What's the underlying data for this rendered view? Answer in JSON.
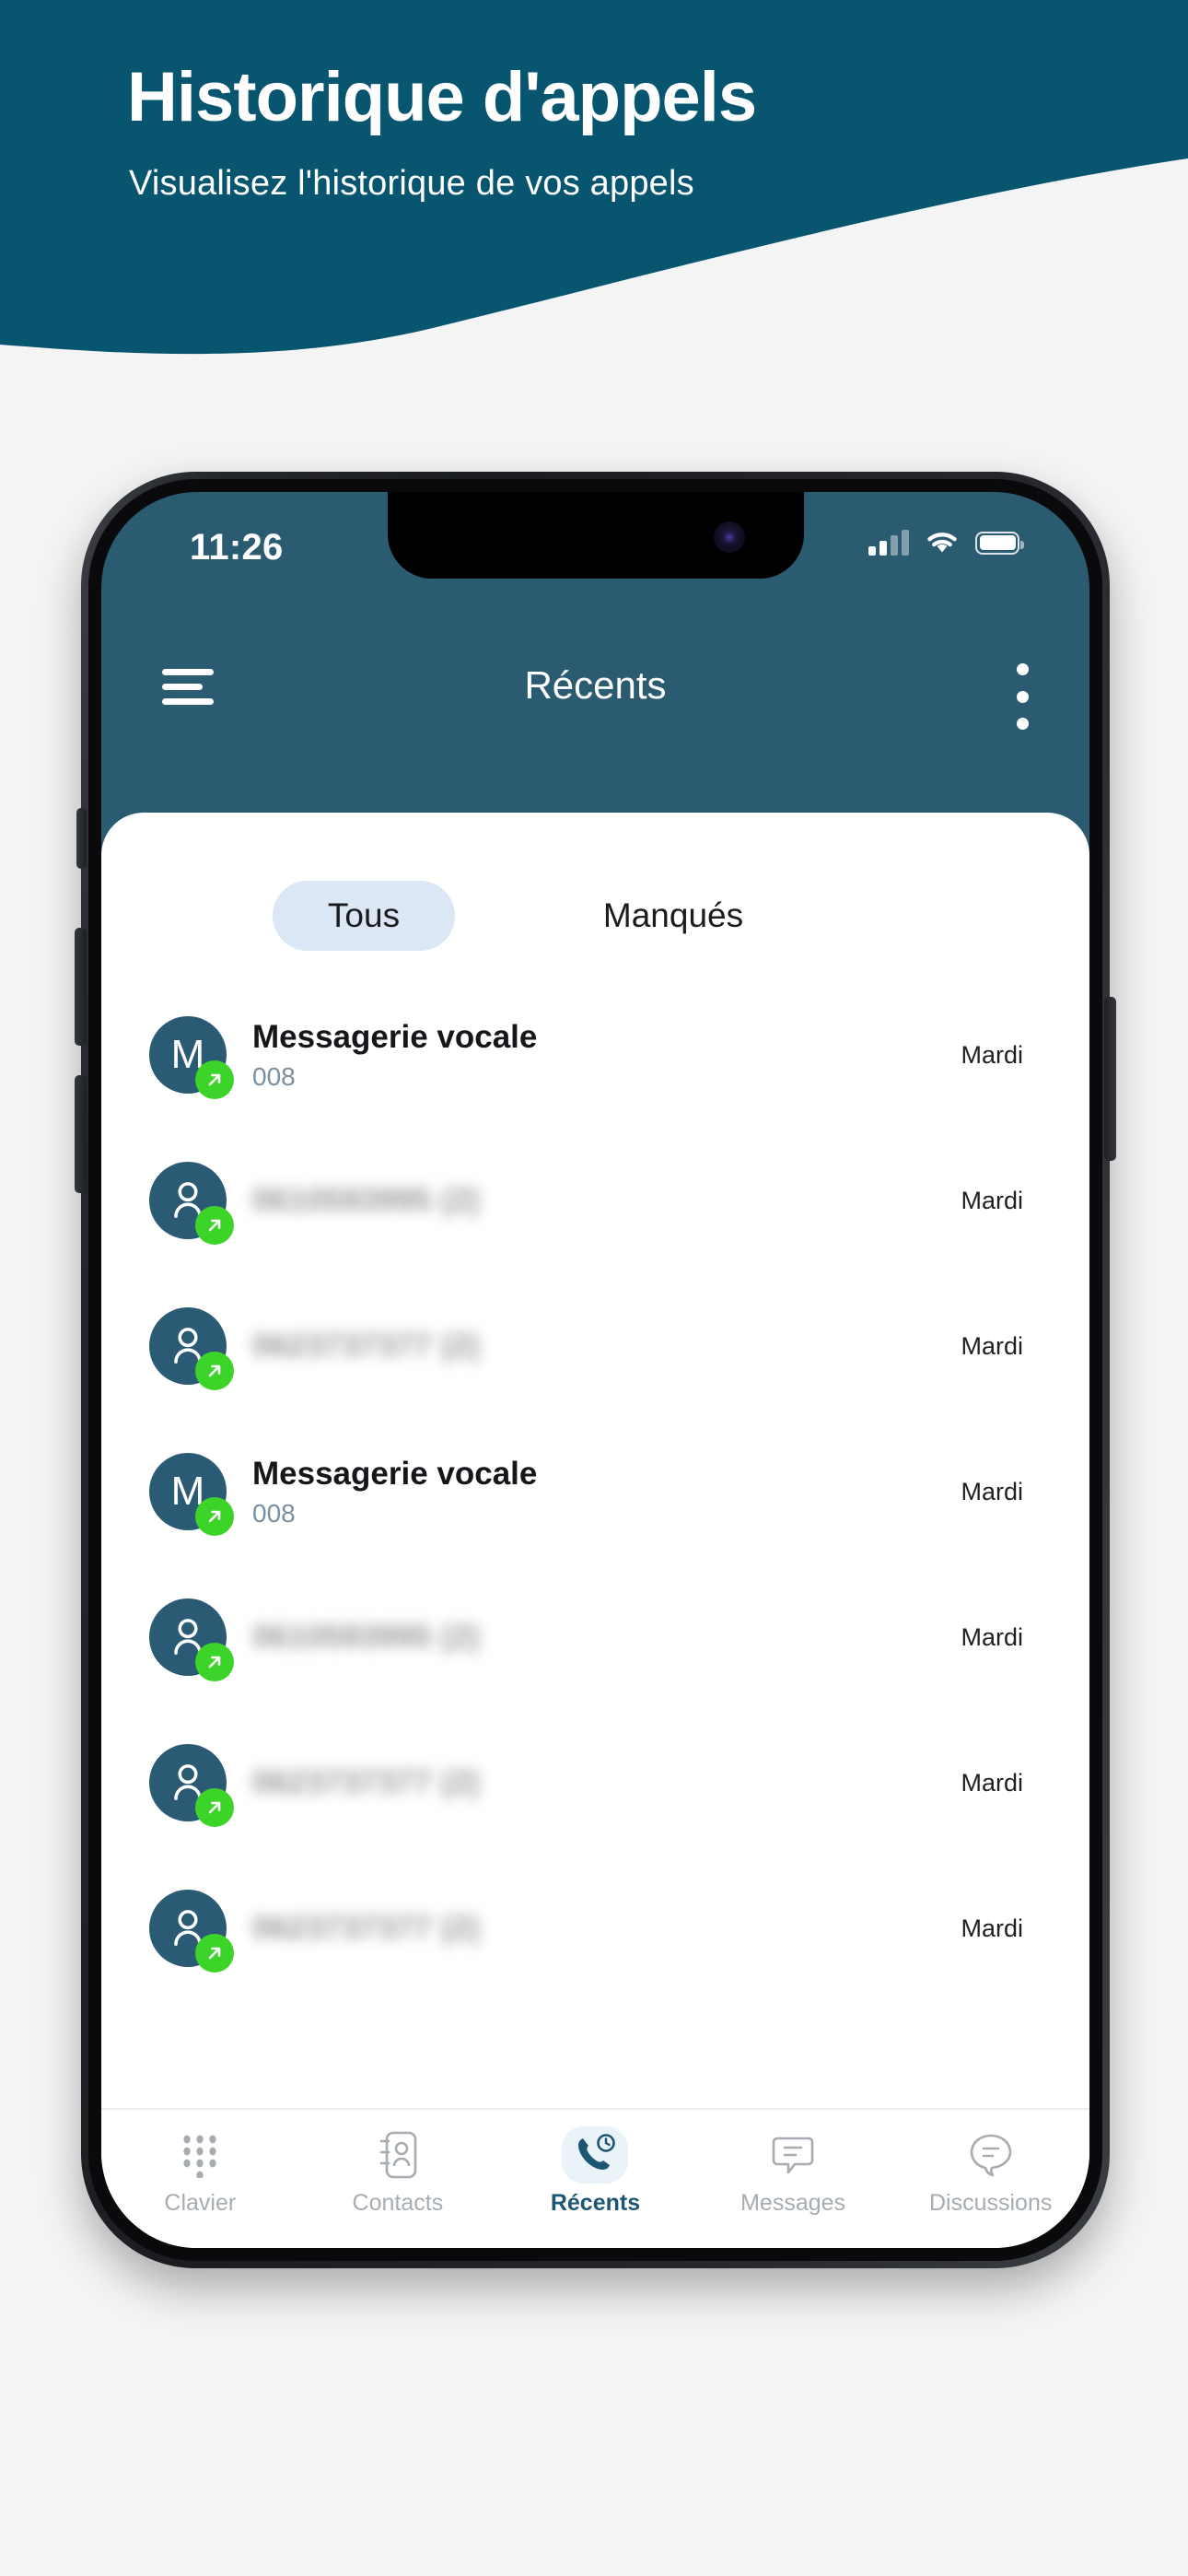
{
  "hero": {
    "title": "Historique d'appels",
    "subtitle": "Visualisez l'historique de vos appels",
    "bg_color": "#085570"
  },
  "phone": {
    "status_bar": {
      "time": "11:26",
      "signal_icon": "signal-bars-icon",
      "wifi_icon": "wifi-icon",
      "battery_icon": "battery-full-icon"
    },
    "app_bar": {
      "menu_icon": "hamburger-menu-icon",
      "title": "Récents",
      "overflow_icon": "kebab-menu-icon",
      "bg_color": "#2b5b70"
    },
    "segments": [
      {
        "label": "Tous",
        "selected": true
      },
      {
        "label": "Manqués",
        "selected": false
      }
    ],
    "calls": [
      {
        "avatar_type": "initial",
        "initial": "M",
        "title": "Messagerie vocale",
        "subtitle": "008",
        "time": "Mardi",
        "direction_icon": "outgoing-call-icon",
        "blurred": false
      },
      {
        "avatar_type": "person",
        "initial": "",
        "title": "0610593995 (2)",
        "subtitle": "",
        "time": "Mardi",
        "direction_icon": "outgoing-call-icon",
        "blurred": true
      },
      {
        "avatar_type": "person",
        "initial": "",
        "title": "0623737377 (2)",
        "subtitle": "",
        "time": "Mardi",
        "direction_icon": "outgoing-call-icon",
        "blurred": true
      },
      {
        "avatar_type": "initial",
        "initial": "M",
        "title": "Messagerie vocale",
        "subtitle": "008",
        "time": "Mardi",
        "direction_icon": "outgoing-call-icon",
        "blurred": false
      },
      {
        "avatar_type": "person",
        "initial": "",
        "title": "0610593995 (2)",
        "subtitle": "",
        "time": "Mardi",
        "direction_icon": "outgoing-call-icon",
        "blurred": true
      },
      {
        "avatar_type": "person",
        "initial": "",
        "title": "0623737377 (2)",
        "subtitle": "",
        "time": "Mardi",
        "direction_icon": "outgoing-call-icon",
        "blurred": true
      },
      {
        "avatar_type": "person",
        "initial": "",
        "title": "0623737377 (2)",
        "subtitle": "",
        "time": "Mardi",
        "direction_icon": "outgoing-call-icon",
        "blurred": true
      }
    ],
    "tabs": [
      {
        "label": "Clavier",
        "icon": "dialpad-icon",
        "active": false
      },
      {
        "label": "Contacts",
        "icon": "contacts-book-icon",
        "active": false
      },
      {
        "label": "Récents",
        "icon": "recent-calls-icon",
        "active": true
      },
      {
        "label": "Messages",
        "icon": "message-bubble-icon",
        "active": false
      },
      {
        "label": "Discussions",
        "icon": "chat-bubble-icon",
        "active": false
      }
    ],
    "colors": {
      "accent": "#1d5673",
      "avatar": "#2a5a74",
      "badge_green": "#3dd42a",
      "pill": "#dce7f5"
    }
  }
}
